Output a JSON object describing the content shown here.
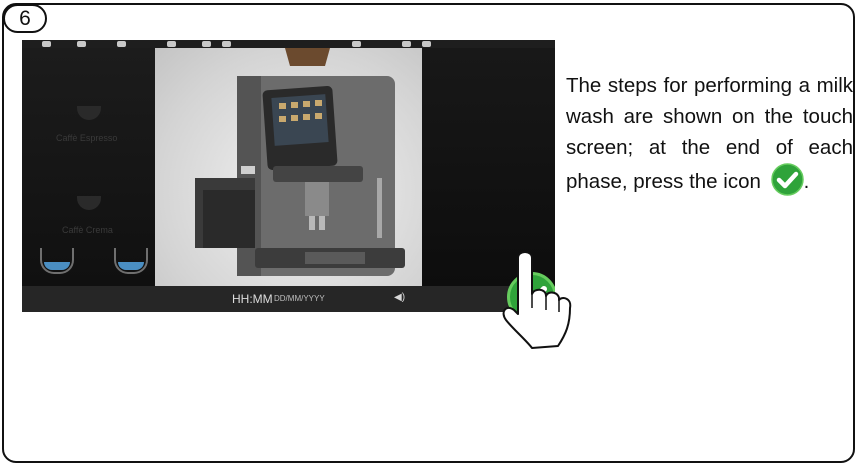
{
  "step": {
    "number": "6"
  },
  "screen": {
    "menu_items": [
      "Caffè Espresso",
      "Caffè Crema"
    ],
    "status": {
      "time": "HH:MM",
      "date": "DD/MM/YYYY"
    }
  },
  "instruction": {
    "text": "The steps for performing a milk wash are shown on the touch screen; at the end of each phase, press the icon",
    "end": "."
  },
  "colors": {
    "confirm_green": "#2fa33a",
    "confirm_ring": "#66cc5e"
  },
  "icons": [
    "check-icon",
    "pointing-hand-icon",
    "speaker-icon"
  ]
}
